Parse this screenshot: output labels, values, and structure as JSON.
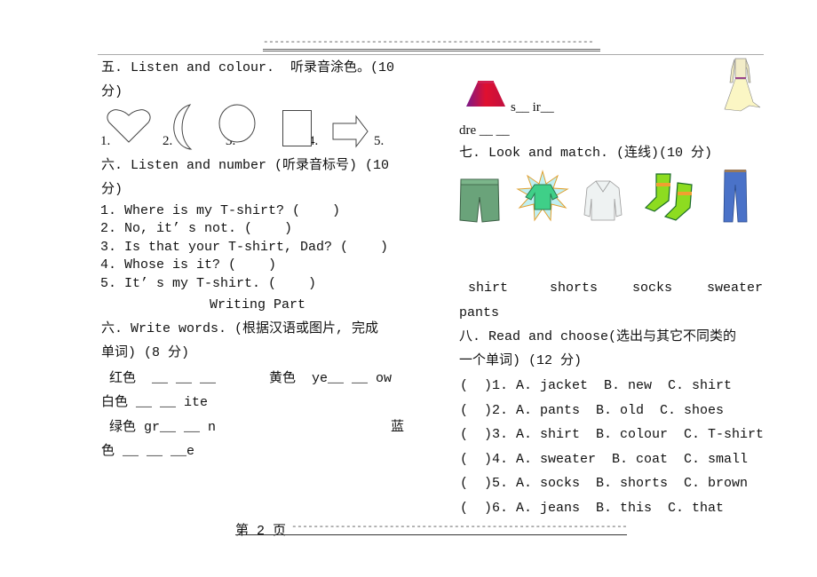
{
  "header": {
    "dash_line": "-------------------------------------------------------------"
  },
  "section5": {
    "title_line1": "五. Listen and colour.  听录音涂色。(10",
    "title_line2": "分)",
    "shape_labels": [
      "1.",
      "2.",
      "3.",
      "4.",
      "5."
    ],
    "shapes": [
      "heart-icon",
      "crescent-moon-icon",
      "circle-icon",
      "rectangle-icon",
      "arrow-right-icon"
    ]
  },
  "section6_listen": {
    "title_line1": "六. Listen and number (听录音标号) (10",
    "title_line2": "分)",
    "items": [
      "1. Where is my T-shirt? (    )",
      "2. No, it’ s not. (    )",
      "3. Is that your T-shirt, Dad? (    )",
      "4. Whose is it? (    )",
      "5. It’ s my T-shirt. (    )"
    ]
  },
  "writing_part": {
    "title": "Writing Part"
  },
  "section6_write": {
    "title_line1": "六. Write words. (根据汉语或图片, 完成",
    "title_line2": "单词) (8 分)",
    "red": " 红色  __ __ __",
    "yellow": "黄色  ye__ __ ow",
    "white": "白色 __ __ ite",
    "green": " 绿色 gr__ __ n",
    "blue_part1": "蓝",
    "blue_part2": "色 __ __ __e",
    "skirt": "s__ ir__",
    "dress": "dre __ __"
  },
  "section7": {
    "title": "七. Look and match. (连线)(10 分)",
    "pictures": [
      "shorts-picture",
      "shirt-picture",
      "sweater-picture",
      "socks-picture",
      "pants-picture"
    ],
    "words_row": [
      " shirt",
      "shorts",
      "socks",
      "sweater"
    ],
    "word_last": "pants"
  },
  "section8": {
    "title_line1": "八. Read and choose(选出与其它不同类的",
    "title_line2": "一个单词) (12 分)",
    "items": [
      "(  )1. A. jacket  B. new  C. shirt",
      "(  )2. A. pants  B. old  C. shoes",
      "(  )3. A. shirt  B. colour  C. T-shirt",
      "(  )4. A. sweater  B. coat  C. small",
      "(  )5. A. socks  B. shorts  C. brown",
      "(  )6. A. jeans  B. this  C. that"
    ]
  },
  "footer": {
    "page_label": "第 2 页",
    "dash_line": "--------------------------------------------------------------"
  }
}
